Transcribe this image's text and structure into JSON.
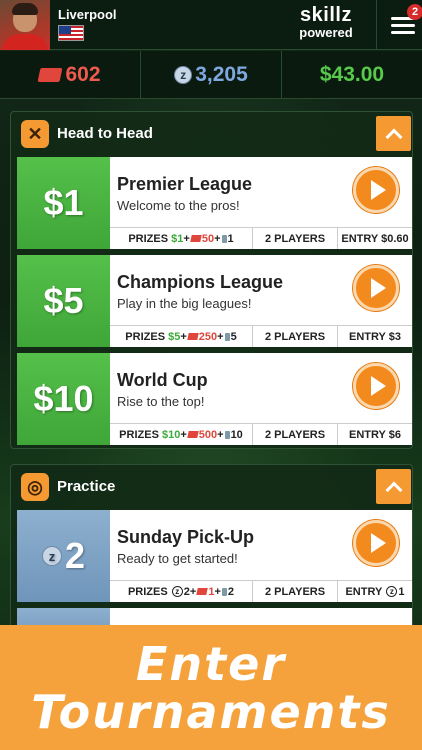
{
  "header": {
    "username": "Liverpool",
    "brand_line1": "skillz",
    "brand_line2": "powered",
    "menu_badge": "2"
  },
  "stats": {
    "tickets": "602",
    "z_coins": "3,205",
    "cash": "$43.00"
  },
  "sections": [
    {
      "title": "Head to Head",
      "cards": [
        {
          "price": "$1",
          "title": "Premier League",
          "subtitle": "Welcome to the pros!",
          "prizes_label": "PRIZES",
          "prize_cash": "$1",
          "prize_tickets": "50",
          "prize_trophy": "1",
          "players": "2 PLAYERS",
          "entry": "ENTRY $0.60"
        },
        {
          "price": "$5",
          "title": "Champions League",
          "subtitle": "Play in the big leagues!",
          "prizes_label": "PRIZES",
          "prize_cash": "$5",
          "prize_tickets": "250",
          "prize_trophy": "5",
          "players": "2 PLAYERS",
          "entry": "ENTRY $3"
        },
        {
          "price": "$10",
          "title": "World Cup",
          "subtitle": "Rise to the top!",
          "prizes_label": "PRIZES",
          "prize_cash": "$10",
          "prize_tickets": "500",
          "prize_trophy": "10",
          "players": "2 PLAYERS",
          "entry": "ENTRY $6"
        }
      ]
    },
    {
      "title": "Practice",
      "cards": [
        {
          "price": "2",
          "title": "Sunday Pick-Up",
          "subtitle": "Ready to get started!",
          "prizes_label": "PRIZES",
          "prize_z": "2",
          "prize_tickets": "1",
          "prize_trophy": "2",
          "players": "2 PLAYERS",
          "entry_label": "ENTRY",
          "entry_z": "1"
        }
      ]
    }
  ],
  "banner": {
    "line1": "Enter",
    "line2": "Tournaments"
  },
  "colors": {
    "accent_orange": "#f59a32",
    "cash_green": "#57c94b",
    "ticket_red": "#e0463b",
    "z_blue": "#7fa7e0"
  }
}
